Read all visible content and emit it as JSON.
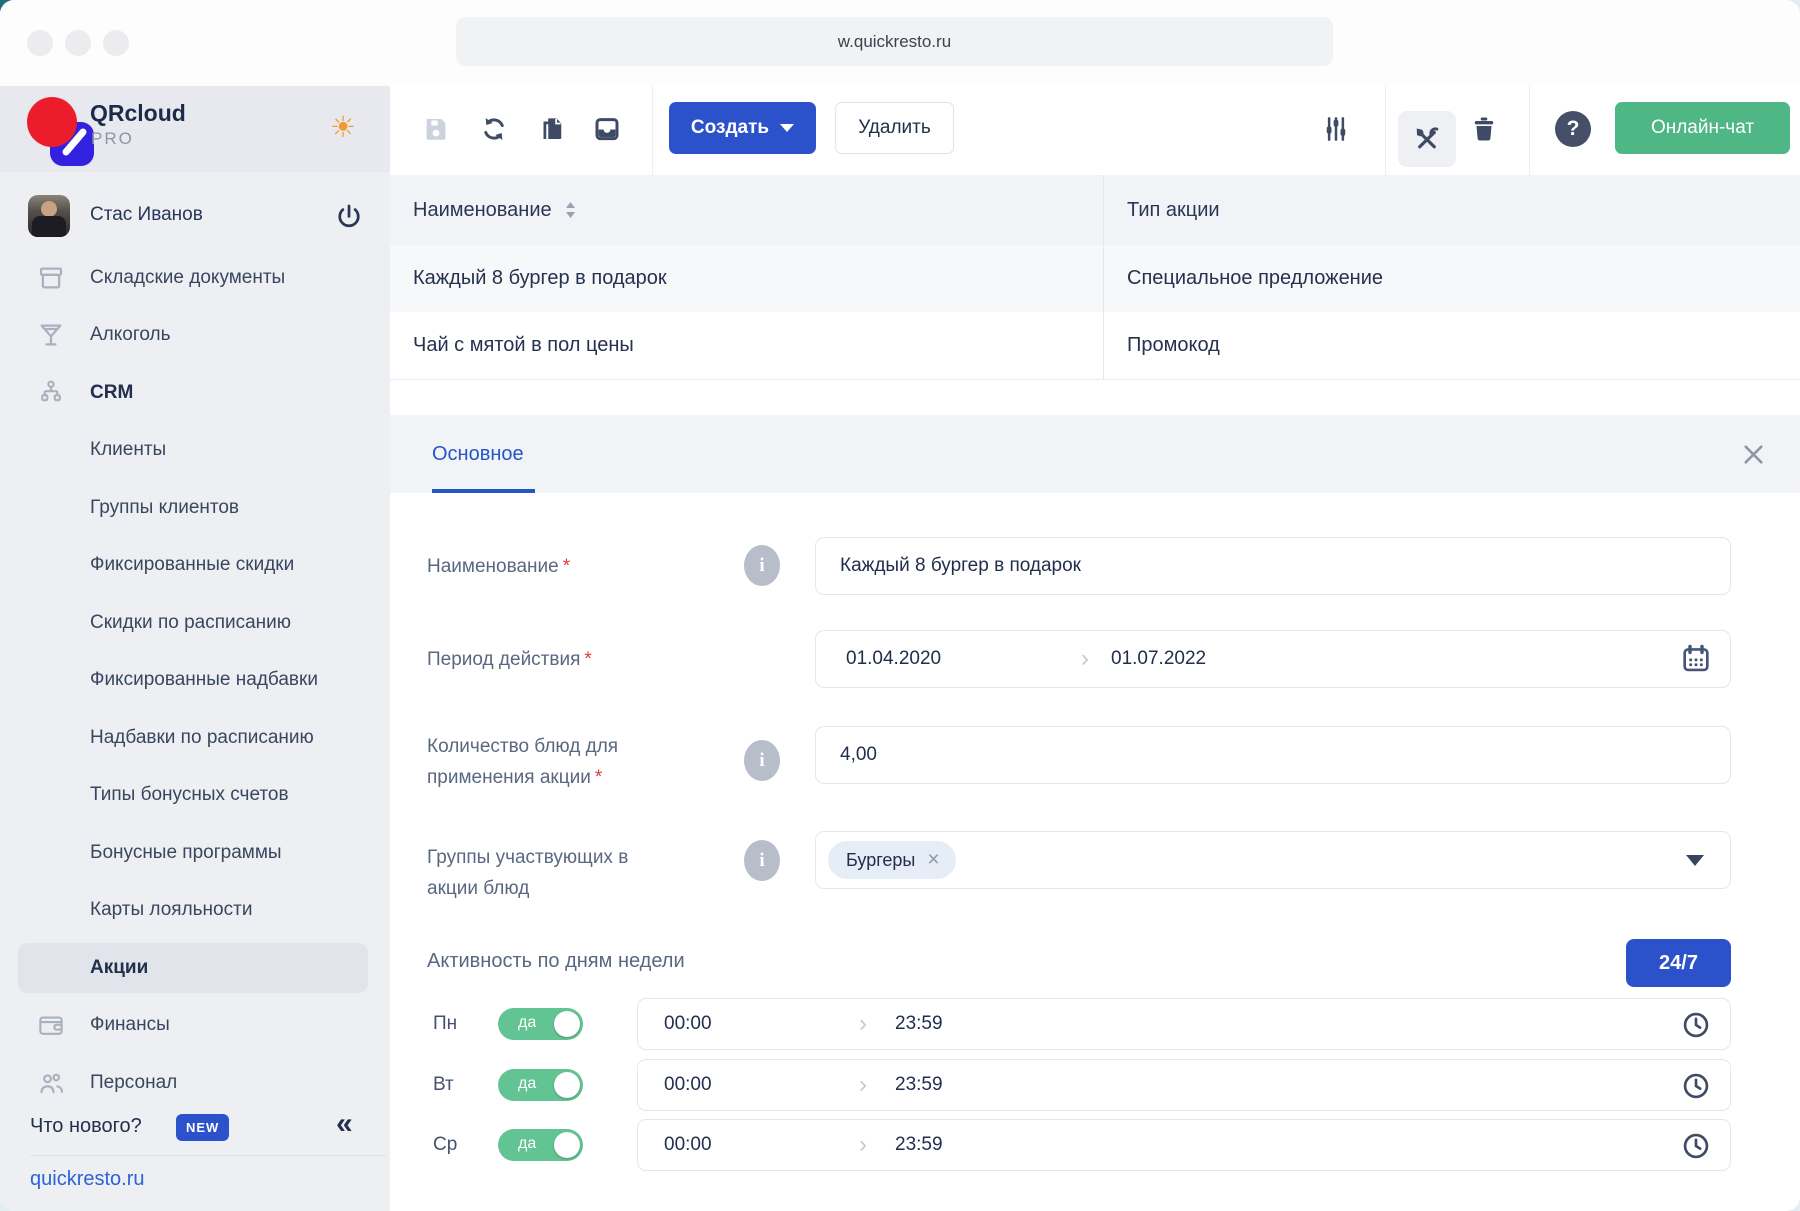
{
  "browser": {
    "url": "w.quickresto.ru"
  },
  "ui": {
    "required_mark": "*"
  },
  "sidebar": {
    "brand": {
      "name": "QRcloud",
      "plan": "PRO"
    },
    "user": {
      "name": "Стас Иванов"
    },
    "items": [
      {
        "label": "Складские документы"
      },
      {
        "label": "Алкоголь"
      },
      {
        "label": "CRM"
      },
      {
        "label": "Клиенты"
      },
      {
        "label": "Группы клиентов"
      },
      {
        "label": "Фиксированные скидки"
      },
      {
        "label": "Скидки по расписанию"
      },
      {
        "label": "Фиксированные надбавки"
      },
      {
        "label": "Надбавки по расписанию"
      },
      {
        "label": "Типы бонусных счетов"
      },
      {
        "label": "Бонусные программы"
      },
      {
        "label": "Карты лояльности"
      },
      {
        "label": "Акции"
      },
      {
        "label": "Финансы"
      },
      {
        "label": "Персонал"
      }
    ],
    "whats_new": {
      "label": "Что нового?",
      "badge": "NEW"
    },
    "site_link": "quickresto.ru"
  },
  "toolbar": {
    "create_label": "Создать",
    "delete_label": "Удалить",
    "chat_label": "Онлайн-чат",
    "help_glyph": "?"
  },
  "table": {
    "columns": [
      "Наименование",
      "Тип акции"
    ],
    "rows": [
      {
        "name": "Каждый 8 бургер в подарок",
        "type": "Специальное предложение"
      },
      {
        "name": "Чай с мятой в пол цены",
        "type": "Промокод"
      }
    ]
  },
  "panel": {
    "tab": "Основное",
    "name_field": {
      "label": "Наименование",
      "value": "Каждый 8 бургер в подарок"
    },
    "period_field": {
      "label": "Период действия",
      "from": "01.04.2020",
      "to": "01.07.2022"
    },
    "quantity_field": {
      "label_line1": "Количество блюд для",
      "label_line2": "применения акции",
      "value": "4,00"
    },
    "groups_field": {
      "label_line1": "Группы участвующих в",
      "label_line2": "акции блюд",
      "chip": "Бургеры"
    },
    "activity": {
      "label": "Активность по дням недели",
      "always_button": "24/7"
    },
    "days": [
      {
        "day": "Пн",
        "state": "да",
        "from": "00:00",
        "to": "23:59"
      },
      {
        "day": "Вт",
        "state": "да",
        "from": "00:00",
        "to": "23:59"
      },
      {
        "day": "Ср",
        "state": "да",
        "from": "00:00",
        "to": "23:59"
      }
    ]
  },
  "glyphs": {
    "sun": "☀",
    "collapse": "«",
    "range_chevron": "›",
    "remove_x": "×",
    "info": "i"
  },
  "colors": {
    "primary_blue": "#2b52cb",
    "chat_green": "#4fb685",
    "toggle_green": "#62c493",
    "logo_red": "#ec1c2d",
    "logo_blue": "#3222e0",
    "required_red": "#e23b3b",
    "accent_orange": "#f09a33"
  }
}
